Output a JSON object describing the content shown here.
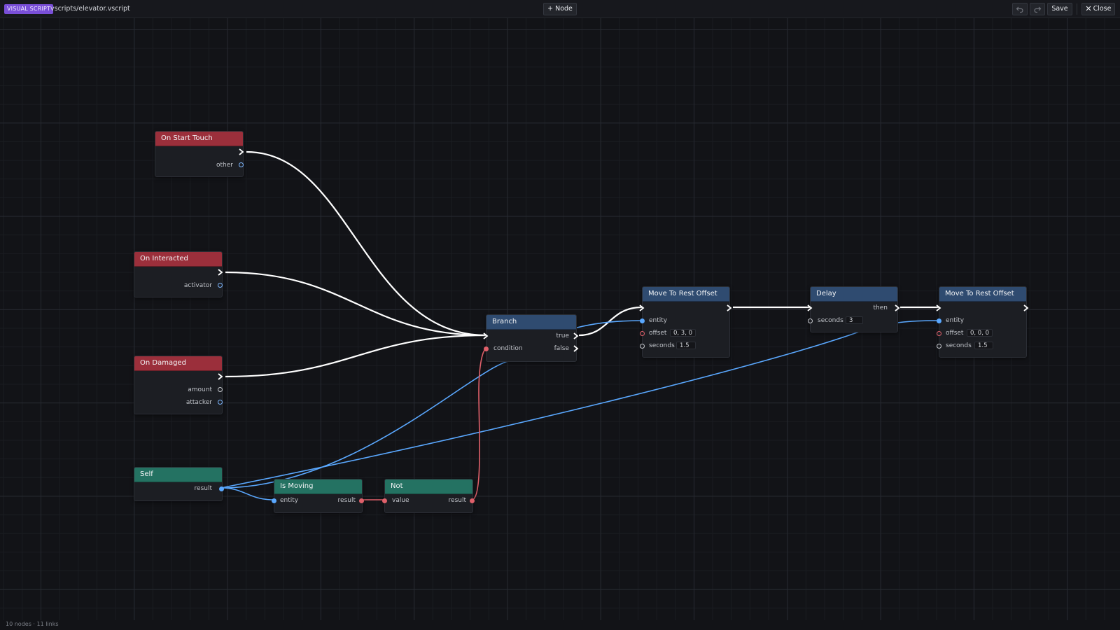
{
  "toolbar": {
    "badge": "VISUAL SCRIPT",
    "file_path": "vscripts/elevator.vscript",
    "add_node_label": "+ Node",
    "undo_icon": "undo-icon",
    "redo_icon": "redo-icon",
    "save_label": "Save",
    "close_label": "Close",
    "close_icon": "close-icon"
  },
  "colors": {
    "event_header": "#9b2f3b",
    "flow_header": "#2f4b70",
    "pure_header": "#247262",
    "entity_wire": "#5aa8ff",
    "bool_wire": "#e0606a",
    "exec_wire": "#ffffff",
    "badge": "#7a4fd8"
  },
  "nodes": {
    "on_start_touch": {
      "title": "On Start Touch",
      "outputs": [
        "other"
      ]
    },
    "on_interacted": {
      "title": "On Interacted",
      "outputs": [
        "activator"
      ]
    },
    "on_damaged": {
      "title": "On Damaged",
      "outputs": [
        "amount",
        "attacker"
      ]
    },
    "self": {
      "title": "Self",
      "outputs": [
        "result"
      ]
    },
    "is_moving": {
      "title": "Is Moving",
      "inputs": [
        "entity"
      ],
      "outputs": [
        "result"
      ]
    },
    "not": {
      "title": "Not",
      "inputs": [
        "value"
      ],
      "outputs": [
        "result"
      ]
    },
    "branch": {
      "title": "Branch",
      "inputs": [
        "condition"
      ],
      "outputs": [
        "true",
        "false"
      ]
    },
    "move1": {
      "title": "Move To Rest Offset",
      "inputs": [
        "entity",
        "offset",
        "seconds"
      ],
      "offset_value": "0, 3, 0",
      "seconds_value": "1.5"
    },
    "delay": {
      "title": "Delay",
      "inputs": [
        "seconds"
      ],
      "outputs": [
        "then"
      ],
      "seconds_value": "3"
    },
    "move2": {
      "title": "Move To Rest Offset",
      "inputs": [
        "entity",
        "offset",
        "seconds"
      ],
      "offset_value": "0, 0, 0",
      "seconds_value": "1.5"
    }
  },
  "status": {
    "text": "10 nodes · 11 links"
  }
}
